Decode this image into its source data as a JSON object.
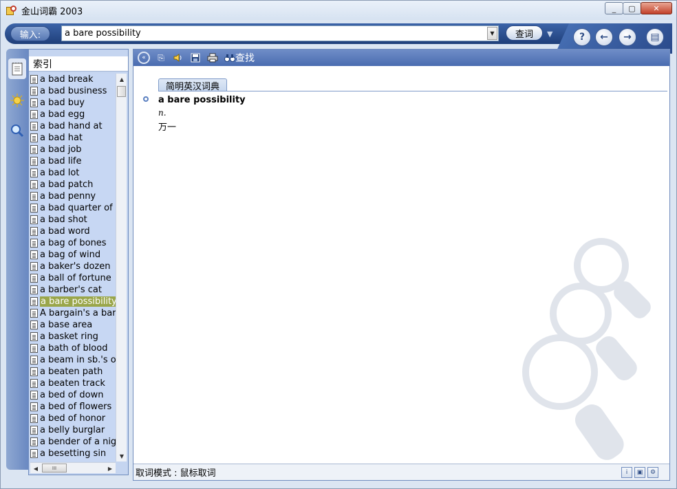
{
  "window": {
    "title": "金山词霸 2003",
    "controls": {
      "minimize": "_",
      "maximize": "▢",
      "close": "✕"
    }
  },
  "input_bar": {
    "label": "输入:",
    "query": "a bare possibility",
    "search_button": "查词",
    "dropdown_glyph": "▼",
    "query_arrow_glyph": "▼",
    "help_glyph": "?",
    "back_glyph": "←",
    "forward_glyph": "→",
    "menu_glyph": "▤"
  },
  "sidebar_tabs": [
    {
      "name": "notebook-icon"
    },
    {
      "name": "sun-icon"
    },
    {
      "name": "magnifier-icon"
    }
  ],
  "index": {
    "header": "索引",
    "items": [
      "a bad break",
      "a bad business",
      "a bad buy",
      "a bad egg",
      "a bad hand at",
      "a bad hat",
      "a bad job",
      "a bad life",
      "a bad lot",
      "a bad patch",
      "a bad penny",
      "a bad quarter of an",
      "a bad shot",
      "a bad word",
      "a bag of bones",
      "a bag of wind",
      "a baker's dozen",
      "a ball of fortune",
      "a barber's cat",
      "a bare possibility",
      "A bargain's a barga",
      "a base area",
      "a basket ring",
      "a bath of blood",
      "a beam in sb.'s ow",
      "a beaten path",
      "a beaten track",
      "a bed of down",
      "a bed of flowers",
      "a bed of honor",
      "a belly burglar",
      "a bender of a night",
      "a besetting sin"
    ],
    "selected_index": 19,
    "scroll_up": "▲",
    "scroll_down": "▼",
    "scroll_left": "◀",
    "scroll_right": "▶",
    "hthumb_glyph": "III"
  },
  "content": {
    "toolbar": {
      "collapse_glyph": "«",
      "copy_glyph": "⎘",
      "speak_glyph": "🔈",
      "save_glyph": "💾",
      "print_glyph": "🖶",
      "find_glyph": "⚲",
      "find_label": "查找"
    },
    "dictionary_tab": "简明英汉词典",
    "headword": "a bare possibility",
    "part_of_speech": "n.",
    "meaning": "万一",
    "status": "取词模式 : 鼠标取词",
    "status_icons": [
      "info-icon",
      "page-icon",
      "wrench-icon"
    ],
    "status_glyphs": [
      "i",
      "▣",
      "⚙"
    ]
  }
}
